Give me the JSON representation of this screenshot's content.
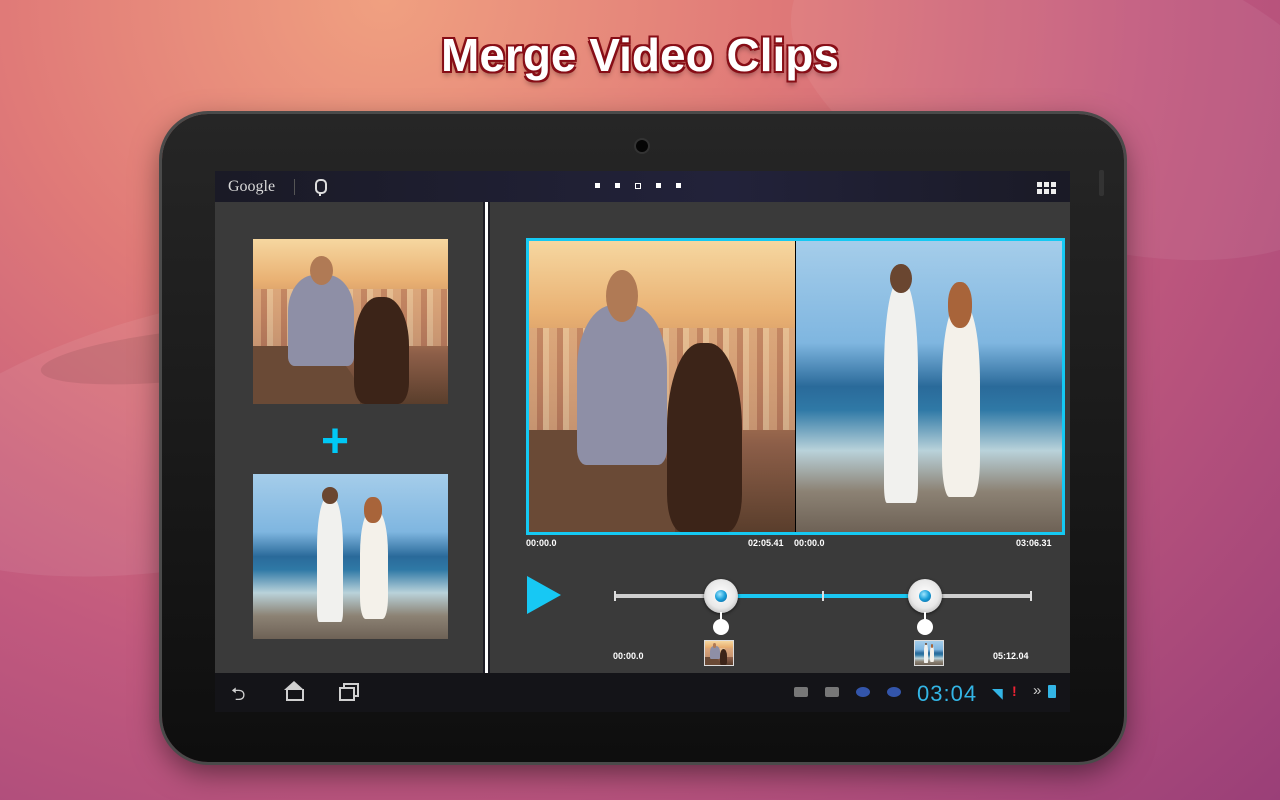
{
  "headline": "Merge Video Clips",
  "statusbar": {
    "search_label": "Google",
    "mic_icon": "mic-icon",
    "apps_icon": "apps-grid-icon",
    "page_count": 5,
    "selected_page": 3
  },
  "clips": {
    "clip1": "couple-city-photo",
    "clip2": "couple-beach-photo",
    "join_symbol": "+"
  },
  "timeline": {
    "clip1_start": "00:00.0",
    "clip1_end": "02:05.41",
    "clip2_start": "00:00.0",
    "clip2_end": "03:06.31",
    "total_start": "00:00.0",
    "total_end": "05:12.04"
  },
  "systembar": {
    "clock": "03:04",
    "wifi_icon": "wifi-icon",
    "battery_icon": "battery-icon"
  },
  "colors": {
    "accent": "#17c8f4",
    "title_outline": "#8a0f18",
    "clock": "#33b5e5"
  }
}
